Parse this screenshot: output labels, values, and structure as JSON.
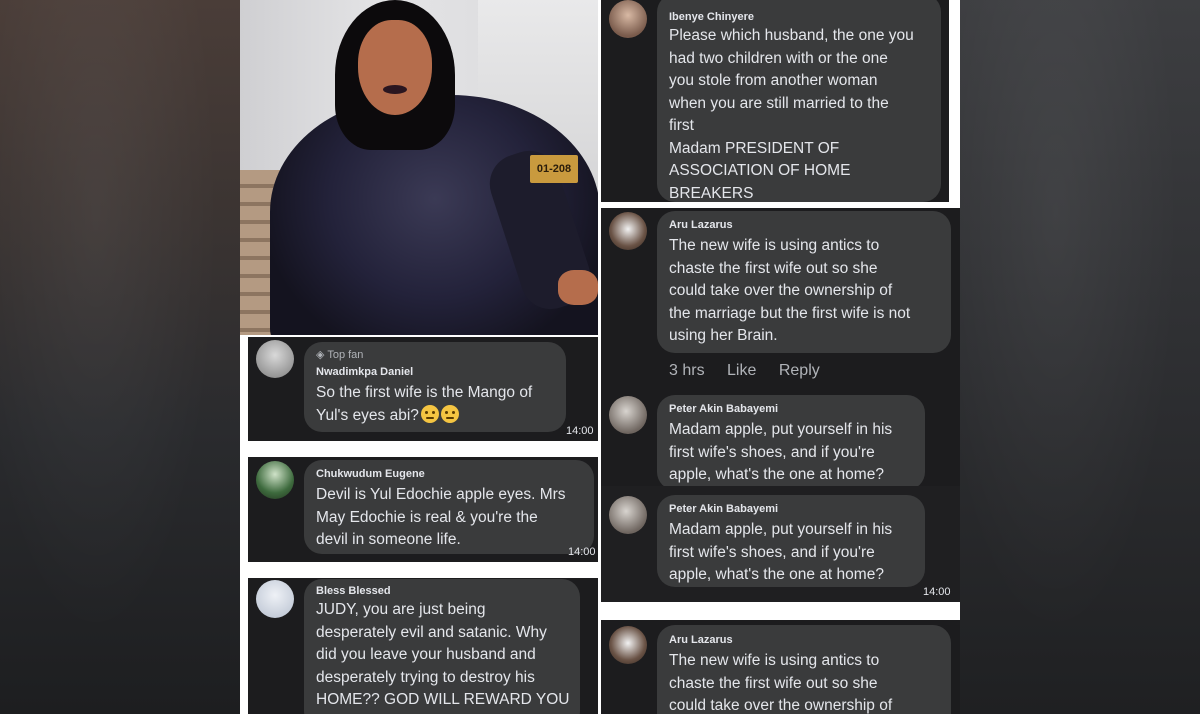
{
  "colors": {
    "comment_bg": "#1c1c1e",
    "bubble": "#3a3b3c",
    "text": "#e4e6eb",
    "muted": "#b0b3b8"
  },
  "photo": {
    "sign_text": "01-208"
  },
  "left_comments": [
    {
      "badge": "Top fan",
      "name": "Nwadimkpa Daniel",
      "lines": [
        "So the first wife is the Mango of",
        "Yul's eyes abi?"
      ],
      "emoji": "confused-face-emoji",
      "time": "14:00"
    },
    {
      "name": "Chukwudum Eugene",
      "lines": [
        "Devil is Yul Edochie apple eyes. Mrs",
        "May Edochie is real & you're the",
        "devil in someone life."
      ],
      "time": "14:00"
    },
    {
      "name": "Bless Blessed",
      "lines": [
        "JUDY, you are just being",
        "desperately evil and satanic. Why",
        "did you leave your husband and",
        "desperately trying to destroy his",
        "HOME?? GOD WILL REWARD YOU"
      ]
    }
  ],
  "right_comments": [
    {
      "name": "Ibenye Chinyere",
      "lines": [
        "Please which husband, the one you",
        "had two children with or the one",
        "you stole from another woman",
        "when you are still married to the",
        "first",
        "Madam PRESIDENT OF",
        "ASSOCIATION OF HOME",
        "BREAKERS"
      ]
    },
    {
      "name": "Aru Lazarus",
      "lines": [
        "The new wife is using antics to",
        "chaste the first wife out so she",
        "could take over the ownership of",
        "the marriage but the first wife is not",
        "using her Brain."
      ],
      "actions": {
        "time": "3 hrs",
        "like": "Like",
        "reply": "Reply"
      }
    },
    {
      "name": "Peter Akin Babayemi",
      "lines": [
        "Madam apple, put yourself in his",
        "first wife's shoes, and if you're",
        "apple, what's the one at home?"
      ]
    },
    {
      "name": "Peter Akin Babayemi",
      "lines": [
        "Madam apple, put yourself in his",
        "first wife's shoes, and if you're",
        "apple, what's the one at home?"
      ],
      "time": "14:00"
    },
    {
      "name": "Aru Lazarus",
      "lines": [
        "The new wife is using antics to",
        "chaste the first wife out so she",
        "could take over the ownership of"
      ]
    }
  ]
}
